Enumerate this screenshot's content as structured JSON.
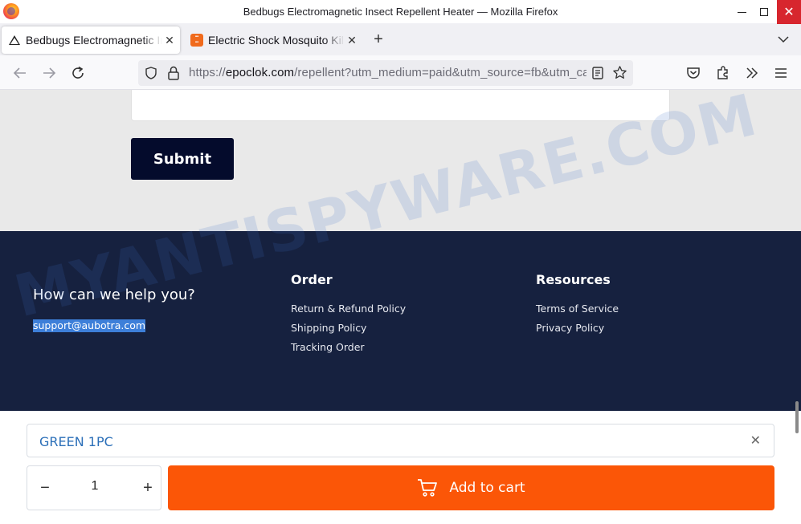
{
  "window": {
    "title": "Bedbugs Electromagnetic Insect Repellent Heater — Mozilla Firefox",
    "close_glyph": "✕"
  },
  "tabs": [
    {
      "label": "Bedbugs Electromagnetic Insect Repellent Heater",
      "icon": "warning-triangle-icon",
      "active": true
    },
    {
      "label": "Electric Shock Mosquito Killer",
      "icon": "shop-favicon-icon",
      "active": false
    }
  ],
  "tab_close_glyph": "✕",
  "new_tab_glyph": "+",
  "url": {
    "prefix": "https://",
    "host": "epoclok.com",
    "path": "/repellent?utm_medium=paid&utm_source=fb&utm_campaign"
  },
  "form": {
    "submit_label": "Submit"
  },
  "footer": {
    "help_heading": "How can we help you?",
    "support_email": "support@aubotra.com",
    "order_title": "Order",
    "order_links": [
      "Return & Refund Policy",
      "Shipping Policy",
      "Tracking Order"
    ],
    "resources_title": "Resources",
    "resources_links": [
      "Terms of Service",
      "Privacy Policy"
    ]
  },
  "cart_bar": {
    "variant": "GREEN 1PC",
    "clear_glyph": "✕",
    "quantity": "1",
    "minus_glyph": "−",
    "plus_glyph": "+",
    "add_label": "Add to cart"
  },
  "watermark": "MYANTISPYWARE.COM",
  "colors": {
    "footer_bg": "#16213f",
    "submit_bg": "#040b2c",
    "add_to_cart_bg": "#fb5607",
    "variant_text": "#2b6fb8",
    "email_highlight": "#3d7fd9"
  }
}
